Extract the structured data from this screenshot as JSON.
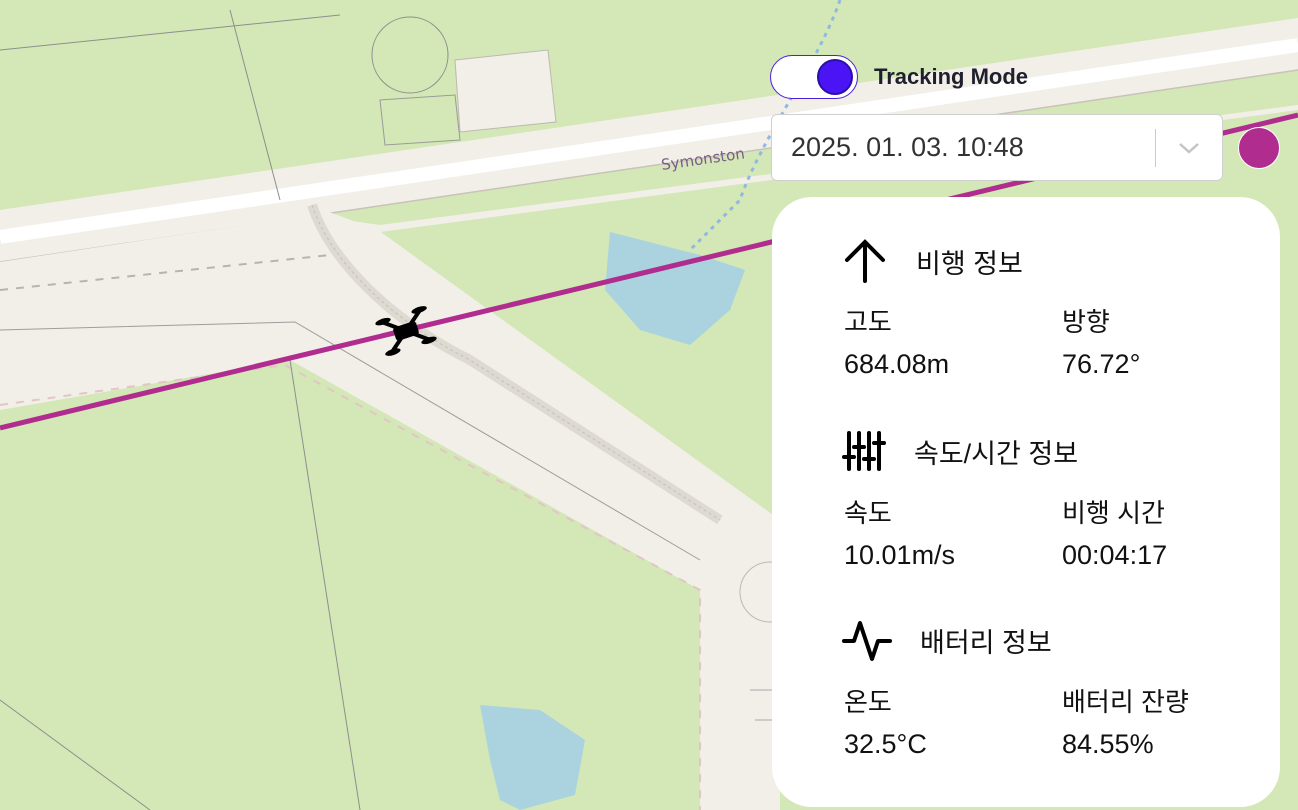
{
  "map": {
    "street_label": "Symonston",
    "colors": {
      "park": "#d3e8b6",
      "road": "#f2efe9",
      "water": "#aad3df",
      "track": "#b02c8e"
    },
    "drone_icon": "drone-icon"
  },
  "tracking": {
    "label": "Tracking Mode",
    "enabled": true,
    "accent": "#4b14f5"
  },
  "datetime": {
    "value": "2025. 01. 03. 10:48",
    "icon": "chevron-down-icon"
  },
  "status_dot_color": "#b02c8e",
  "panel": {
    "flight": {
      "title": "비행 정보",
      "icon": "arrow-up-icon",
      "altitude_label": "고도",
      "altitude_value": "684.08m",
      "heading_label": "방향",
      "heading_value": "76.72°"
    },
    "speed": {
      "title": "속도/시간 정보",
      "icon": "sliders-icon",
      "speed_label": "속도",
      "speed_value": "10.01m/s",
      "flight_time_label": "비행 시간",
      "flight_time_value": "00:04:17"
    },
    "battery": {
      "title": "배터리 정보",
      "icon": "pulse-icon",
      "temperature_label": "온도",
      "temperature_value": "32.5°C",
      "remaining_label": "배터리 잔량",
      "remaining_value": "84.55%"
    }
  }
}
